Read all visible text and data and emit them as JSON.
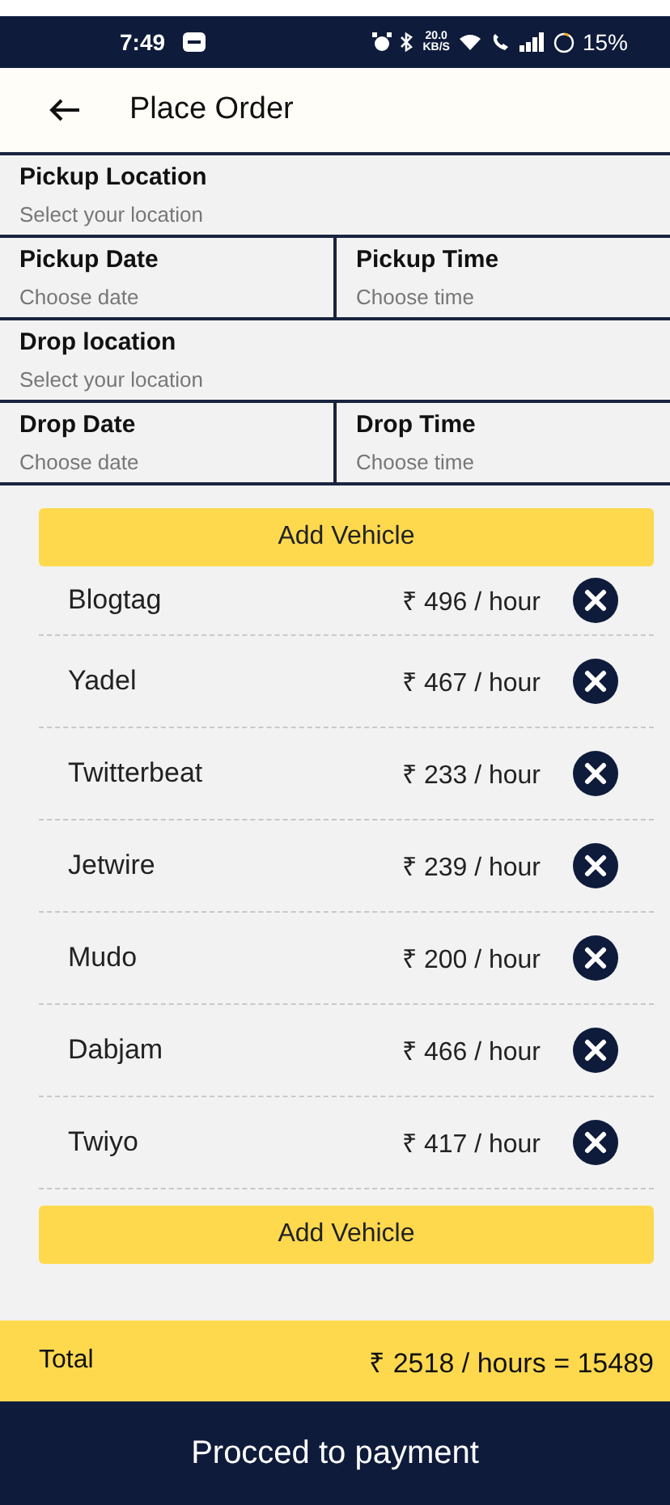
{
  "status_bar": {
    "time": "7:49",
    "speed": "20.0",
    "speed_unit": "KB/S",
    "battery": "15%"
  },
  "header": {
    "title": "Place Order"
  },
  "form": [
    {
      "kind": "single",
      "fields": [
        {
          "label": "Pickup Location",
          "placeholder": "Select your location"
        }
      ]
    },
    {
      "kind": "pair",
      "fields": [
        {
          "label": "Pickup Date",
          "placeholder": "Choose date"
        },
        {
          "label": "Pickup Time",
          "placeholder": "Choose time"
        }
      ]
    },
    {
      "kind": "single",
      "fields": [
        {
          "label": "Drop location",
          "placeholder": "Select your location"
        }
      ]
    },
    {
      "kind": "pair",
      "fields": [
        {
          "label": "Drop Date",
          "placeholder": "Choose date"
        },
        {
          "label": "Drop Time",
          "placeholder": "Choose time"
        }
      ]
    }
  ],
  "add_vehicle_top": "Add Vehicle",
  "vehicles": [
    {
      "name": "Blogtag",
      "rate": "₹ 496 / hour"
    },
    {
      "name": "Yadel",
      "rate": "₹ 467 / hour"
    },
    {
      "name": "Twitterbeat",
      "rate": "₹ 233 / hour"
    },
    {
      "name": "Jetwire",
      "rate": "₹ 239 / hour"
    },
    {
      "name": "Mudo",
      "rate": "₹ 200 / hour"
    },
    {
      "name": "Dabjam",
      "rate": "₹ 466 / hour"
    },
    {
      "name": "Twiyo",
      "rate": "₹ 417 / hour"
    }
  ],
  "add_vehicle_bottom": "Add Vehicle",
  "total": {
    "label": "Total",
    "value": "₹ 2518 / hours = 15489"
  },
  "pay_button": "Procced to payment"
}
